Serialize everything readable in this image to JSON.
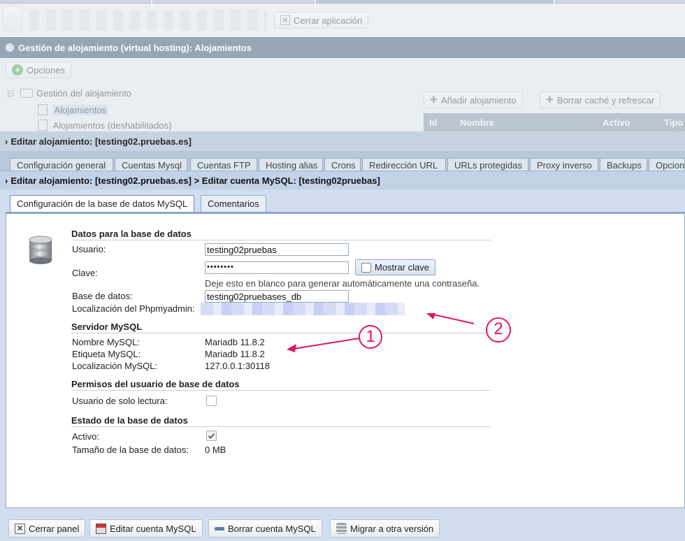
{
  "top": {
    "close_app": "Cerrar aplicación"
  },
  "hosting_window": {
    "title": "Gestión de alojamiento (virtual hosting): Alojamientos",
    "options_label": "Opciones",
    "tree": {
      "root": "Gestión del alojamiento",
      "items": [
        "Alojamientos",
        "Alojamientos (deshabilitados)"
      ]
    },
    "grid_toolbar": {
      "add": "Añadir alojamiento",
      "refresh": "Borrar caché y refrescar"
    },
    "grid_columns": [
      "Id",
      "Nombre",
      "Activo",
      "Tipo"
    ]
  },
  "edit_hosting": {
    "title": "Editar alojamiento: [testing02.pruebas.es]",
    "tabs": [
      "Configuración general",
      "Cuentas Mysql",
      "Cuentas FTP",
      "Hosting alias",
      "Crons",
      "Redirección URL",
      "URLs protegidas",
      "Proxy inverso",
      "Backups",
      "Opcion"
    ]
  },
  "edit_mysql": {
    "title": "Editar alojamiento: [testing02.pruebas.es] > Editar cuenta MySQL: [testing02pruebas]",
    "tabs": [
      "Configuración de la base de datos MySQL",
      "Comentarios"
    ],
    "db_section": {
      "heading": "Datos para la base de datos",
      "user_label": "Usuario:",
      "user_value": "testing02pruebas",
      "password_label": "Clave:",
      "password_value": "••••••••",
      "show_password": "Mostrar clave",
      "password_hint": "Deje esto en blanco para generar automáticamente una contraseña.",
      "db_label": "Base de datos:",
      "db_value": "testing02pruebases_db",
      "phpmyadmin_label": "Localización del Phpmyadmin:"
    },
    "server_section": {
      "heading": "Servidor MySQL",
      "name_label": "Nombre MySQL:",
      "name_value": "Mariadb 11.8.2",
      "tag_label": "Etiqueta MySQL:",
      "tag_value": "Mariadb 11.8.2",
      "location_label": "Localización MySQL:",
      "location_value": "127.0.0.1:30118"
    },
    "perm_section": {
      "heading": "Permisos del usuario de base de datos",
      "readonly_label": "Usuario de solo lectura:",
      "readonly_checked": false
    },
    "state_section": {
      "heading": "Estado de la base de datos",
      "active_label": "Activo:",
      "active_checked": true,
      "size_label": "Tamaño de la base de datos:",
      "size_value": "0 MB"
    },
    "buttons": {
      "close": "Cerrar panel",
      "edit": "Editar cuenta MySQL",
      "delete": "Borrar cuenta MySQL",
      "migrate": "Migrar a otra versión"
    }
  },
  "annotations": {
    "marker_1": "1",
    "marker_2": "2",
    "color": "#e0156b"
  }
}
